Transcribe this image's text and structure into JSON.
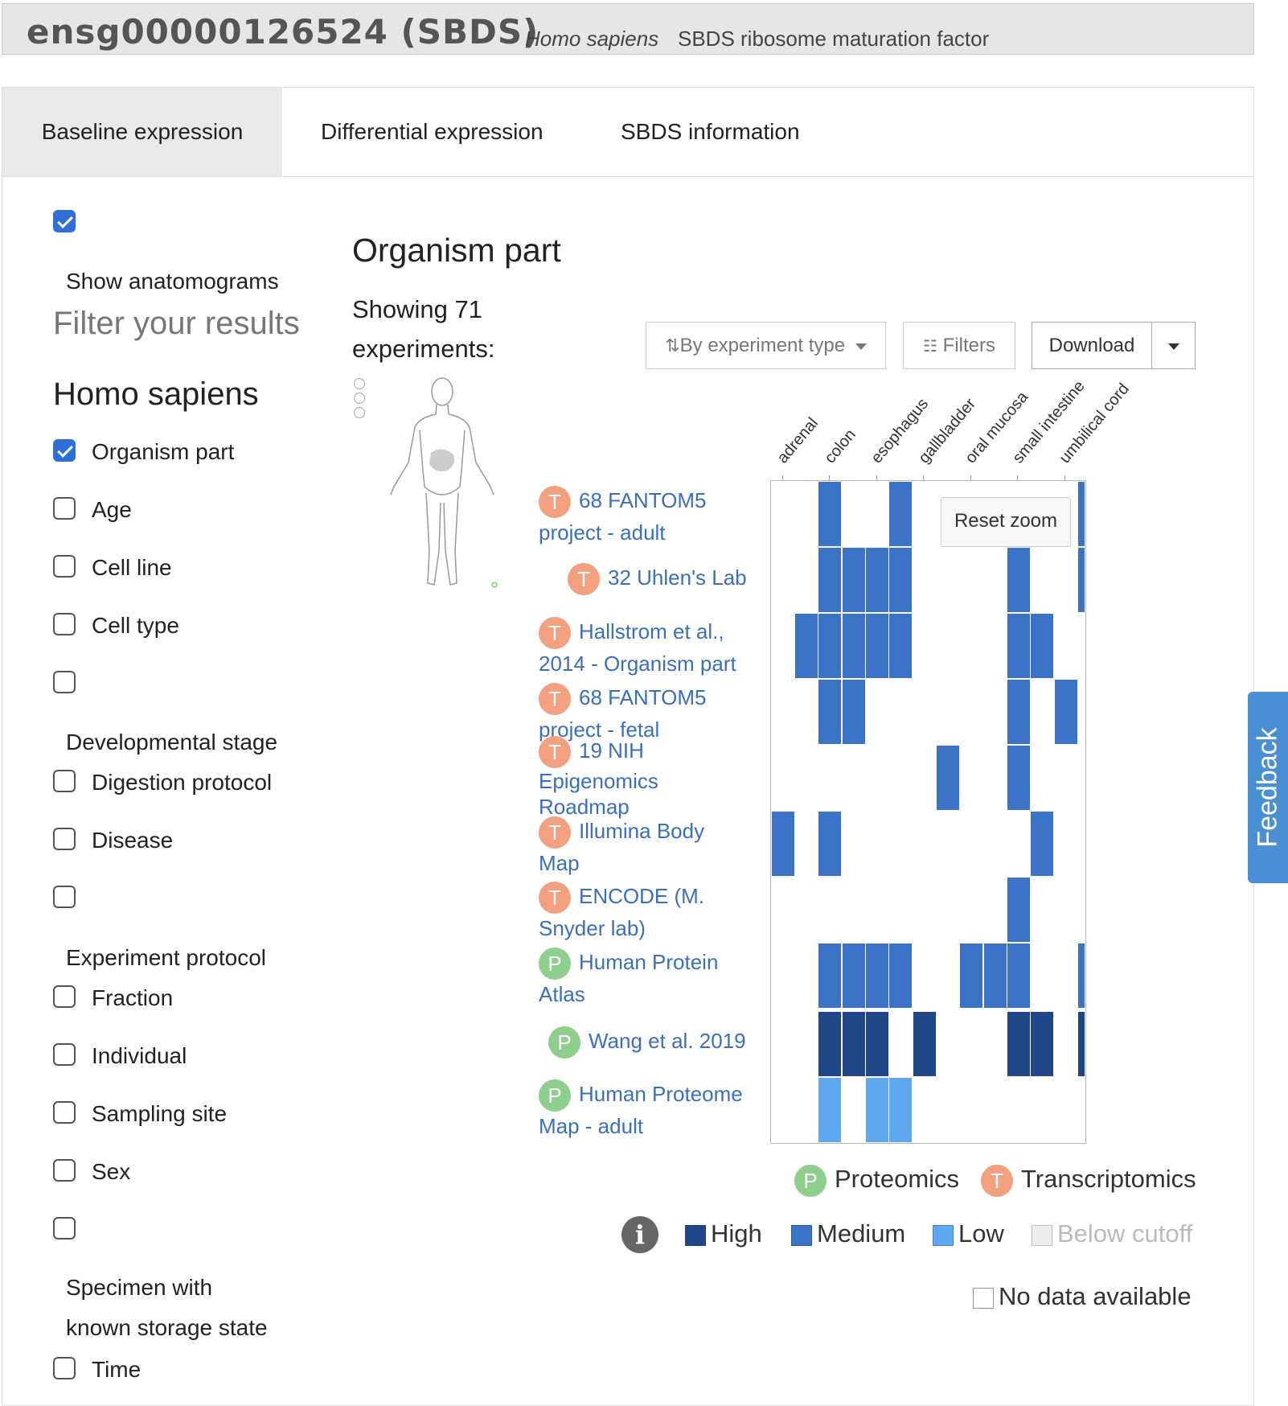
{
  "header": {
    "gene_id": "ensg00000126524 (SBDS)",
    "species": "Homo sapiens",
    "description": "SBDS ribosome maturation factor"
  },
  "tabs": [
    {
      "label": "Baseline expression",
      "active": true
    },
    {
      "label": "Differential expression",
      "active": false
    },
    {
      "label": "SBDS information",
      "active": false
    }
  ],
  "sidebar": {
    "show_anatomograms": {
      "label": "Show anatomograms",
      "checked": true
    },
    "filter_title": "Filter your results",
    "species_title": "Homo sapiens",
    "filters": [
      {
        "label": "Organism part",
        "checked": true
      },
      {
        "label": "Age",
        "checked": false
      },
      {
        "label": "Cell line",
        "checked": false
      },
      {
        "label": "Cell type",
        "checked": false
      },
      {
        "label": "Developmental stage",
        "checked": false
      },
      {
        "label": "Digestion protocol",
        "checked": false
      },
      {
        "label": "Disease",
        "checked": false
      },
      {
        "label": "Experiment protocol",
        "checked": false
      },
      {
        "label": "Fraction",
        "checked": false
      },
      {
        "label": "Individual",
        "checked": false
      },
      {
        "label": "Sampling site",
        "checked": false
      },
      {
        "label": "Sex",
        "checked": false
      },
      {
        "label": "Specimen with",
        "label2": "known storage state",
        "checked": false
      },
      {
        "label": "Time",
        "checked": false
      }
    ]
  },
  "main": {
    "section_title": "Organism part",
    "showing_line1": "Showing 71",
    "showing_line2": "experiments:",
    "sort_button": "By experiment type",
    "filters_button": "Filters",
    "download_button": "Download",
    "reset_zoom": "Reset zoom"
  },
  "heatmap": {
    "columns": [
      "adrenal",
      "colon",
      "esophagus",
      "gallbladder",
      "oral mucosa",
      "small intestine",
      "umbilical cord"
    ],
    "rows": [
      {
        "badge": "T",
        "label1": "68 FANTOM5",
        "label2": "project - adult"
      },
      {
        "badge": "T",
        "label1": "32 Uhlen's Lab",
        "label2": ""
      },
      {
        "badge": "T",
        "label1": "Hallstrom et al.,",
        "label2": "2014 - Organism part"
      },
      {
        "badge": "T",
        "label1": "68 FANTOM5",
        "label2": "project - fetal"
      },
      {
        "badge": "T",
        "label1": "19 NIH",
        "label2": "Epigenomics",
        "label3": "Roadmap"
      },
      {
        "badge": "T",
        "label1": "Illumina Body",
        "label2": "Map"
      },
      {
        "badge": "T",
        "label1": "ENCODE (M.",
        "label2": "Snyder lab)"
      },
      {
        "badge": "P",
        "label1": "Human Protein",
        "label2": "Atlas"
      },
      {
        "badge": "P",
        "label1": "Wang et al. 2019",
        "label2": ""
      },
      {
        "badge": "P",
        "label1": "Human Proteome",
        "label2": "Map - adult"
      }
    ]
  },
  "legend": {
    "proteomics_badge": "P",
    "proteomics": "Proteomics",
    "transcriptomics_badge": "T",
    "transcriptomics": "Transcriptomics",
    "high": "High",
    "medium": "Medium",
    "low": "Low",
    "below_cutoff": "Below cutoff",
    "no_data": "No data available",
    "colors": {
      "high": "#1f4788",
      "medium": "#3b73c8",
      "low": "#5fa8ee",
      "below": "#eeeeee"
    }
  },
  "feedback": "Feedback"
}
